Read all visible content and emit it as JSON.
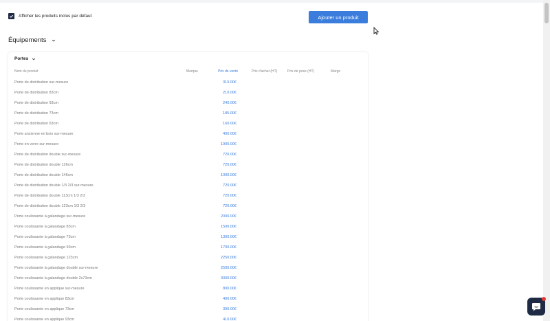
{
  "toolbar": {
    "show_included_label": "Afficher les produits inclus par défaut",
    "add_product_label": "Ajouter un produit"
  },
  "section": {
    "title": "Équipements"
  },
  "card": {
    "title": "Portes"
  },
  "columns": {
    "name": "Nom du produit",
    "brand": "Marque",
    "sale_price": "Prix de vente",
    "purchase_price": "Prix d'achat (HT)",
    "install_price": "Prix de pose (HT)",
    "margin": "Marge"
  },
  "products": [
    {
      "name": "Porte de distribution sur-mesure",
      "price": "310.00€"
    },
    {
      "name": "Porte de distribution 83cm",
      "price": "210.00€"
    },
    {
      "name": "Porte de distribution 93cm",
      "price": "240.00€"
    },
    {
      "name": "Porte de distribution 73cm",
      "price": "185.00€"
    },
    {
      "name": "Porte de distribution 63cm",
      "price": "160.00€"
    },
    {
      "name": "Porte ancienne en bois sur-mesure",
      "price": "400.00€"
    },
    {
      "name": "Porte en verre sur-mesure",
      "price": "1900.00€"
    },
    {
      "name": "Porte de distribution double sur-mesure",
      "price": "720.00€"
    },
    {
      "name": "Porte de distribution double 126cm",
      "price": "720.00€"
    },
    {
      "name": "Porte de distribution double 146cm",
      "price": "1000.00€"
    },
    {
      "name": "Porte de distribution double 1/3 2/3 sur-mesure",
      "price": "720.00€"
    },
    {
      "name": "Porte de distribution double 113cm 1/3 2/3",
      "price": "720.00€"
    },
    {
      "name": "Porte de distribution double 123cm 1/3 2/3",
      "price": "720.00€"
    },
    {
      "name": "Porte coulissante à galandage sur-mesure",
      "price": "2000.00€"
    },
    {
      "name": "Porte coulissante à galandage 83cm",
      "price": "1500.00€"
    },
    {
      "name": "Porte coulissante à galandage 73cm",
      "price": "1300.00€"
    },
    {
      "name": "Porte coulissante à galandage 93cm",
      "price": "1700.00€"
    },
    {
      "name": "Porte coulissante à galandage 123cm",
      "price": "2250.00€"
    },
    {
      "name": "Porte coulissante à galandage double sur-mesure",
      "price": "2500.00€"
    },
    {
      "name": "Porte coulissante à galandage double 2x73cm",
      "price": "3000.00€"
    },
    {
      "name": "Porte coulissante en applique sur-mesure",
      "price": "800.00€"
    },
    {
      "name": "Porte coulissante en applique 83cm",
      "price": "400.00€"
    },
    {
      "name": "Porte coulissante en applique 73cm",
      "price": "390.00€"
    },
    {
      "name": "Porte coulissante en applique 93cm",
      "price": "410.00€"
    }
  ]
}
